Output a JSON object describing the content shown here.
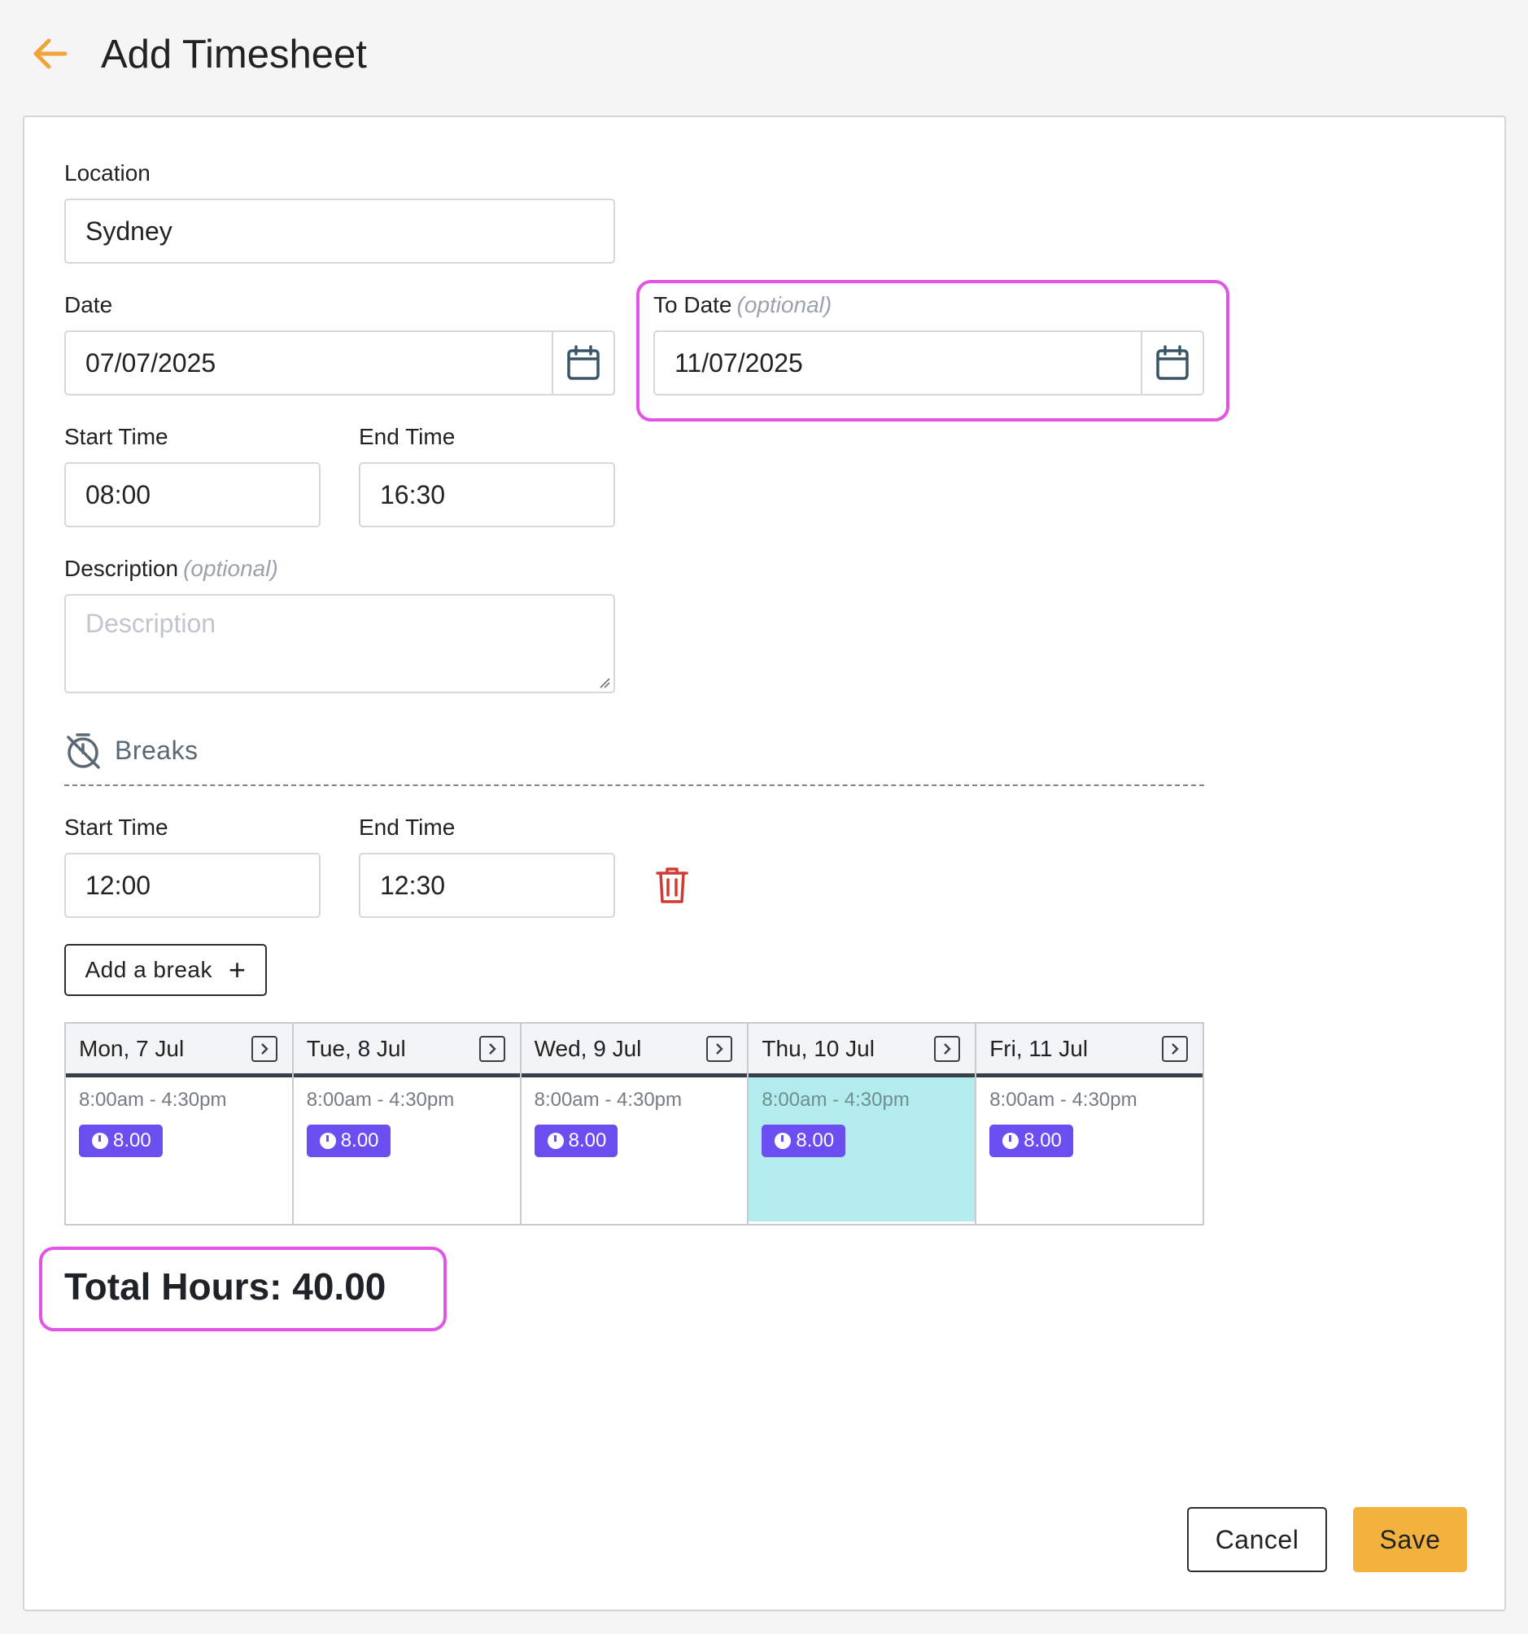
{
  "header": {
    "title": "Add Timesheet",
    "back_icon": "arrow-left-icon",
    "accent_color": "#f0a43a"
  },
  "form": {
    "location": {
      "label": "Location",
      "value": "Sydney"
    },
    "date": {
      "label": "Date",
      "value": "07/07/2025"
    },
    "to_date": {
      "label": "To Date",
      "optional": "(optional)",
      "value": "11/07/2025"
    },
    "start_time": {
      "label": "Start Time",
      "value": "08:00"
    },
    "end_time": {
      "label": "End Time",
      "value": "16:30"
    },
    "description": {
      "label": "Description",
      "optional": "(optional)",
      "placeholder": "Description"
    }
  },
  "breaks": {
    "title": "Breaks",
    "start_label": "Start Time",
    "end_label": "End Time",
    "start_value": "12:00",
    "end_value": "12:30",
    "add_label": "Add a break",
    "add_icon": "+"
  },
  "week": {
    "days": [
      {
        "name": "Mon, 7 Jul",
        "shift": "8:00am - 4:30pm",
        "hours": "8.00"
      },
      {
        "name": "Tue, 8 Jul",
        "shift": "8:00am - 4:30pm",
        "hours": "8.00"
      },
      {
        "name": "Wed, 9 Jul",
        "shift": "8:00am - 4:30pm",
        "hours": "8.00"
      },
      {
        "name": "Thu, 10 Jul",
        "shift": "8:00am - 4:30pm",
        "hours": "8.00"
      },
      {
        "name": "Fri, 11 Jul",
        "shift": "8:00am - 4:30pm",
        "hours": "8.00"
      }
    ],
    "selected_day": "Thu, 10 Jul",
    "badge_color": "#6b4ef0",
    "selected_color": "#b3ecec"
  },
  "summary": {
    "total": "Total Hours: 40.00"
  },
  "actions": {
    "cancel": "Cancel",
    "save": "Save",
    "save_color": "#f3b23e"
  },
  "highlight_color": "#e154e6"
}
